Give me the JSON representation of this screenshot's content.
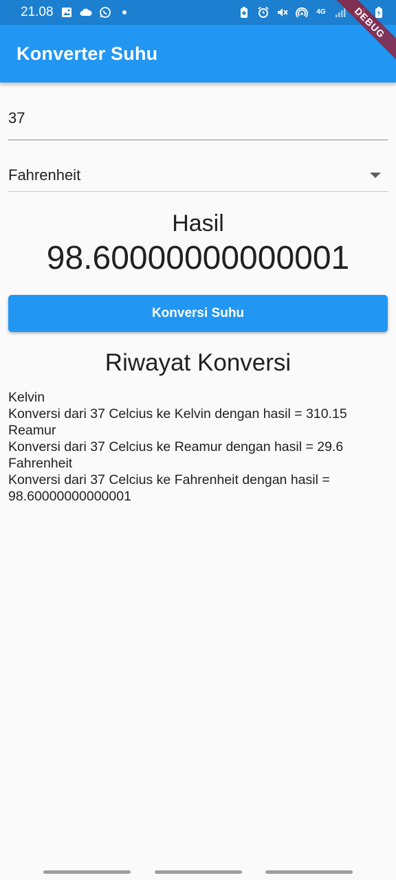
{
  "status_bar": {
    "time": "21.08",
    "network_label": "4G",
    "icons": [
      "image-icon",
      "cloud-icon",
      "whatsapp-icon",
      "dot-icon",
      "battery-saver-icon",
      "alarm-icon",
      "mute-icon",
      "hotspot-icon",
      "signal-icon",
      "signal-icon-2",
      "battery-icon"
    ]
  },
  "app_bar": {
    "title": "Konverter Suhu"
  },
  "debug_banner": "DEBUG",
  "input": {
    "value": "37"
  },
  "dropdown": {
    "selected": "Fahrenheit"
  },
  "result": {
    "label": "Hasil",
    "value": "98.60000000000001"
  },
  "button": {
    "label": "Konversi Suhu"
  },
  "history": {
    "title": "Riwayat Konversi",
    "items": [
      "Kelvin",
      "Konversi dari 37 Celcius ke Kelvin dengan hasil = 310.15",
      "Reamur",
      "Konversi dari 37 Celcius ke Reamur dengan hasil = 29.6",
      "Fahrenheit",
      "Konversi dari 37 Celcius ke Fahrenheit dengan hasil = 98.60000000000001"
    ]
  },
  "colors": {
    "primary": "#2196f3",
    "status_bar": "#1d7fcf",
    "background": "#fafafa"
  }
}
